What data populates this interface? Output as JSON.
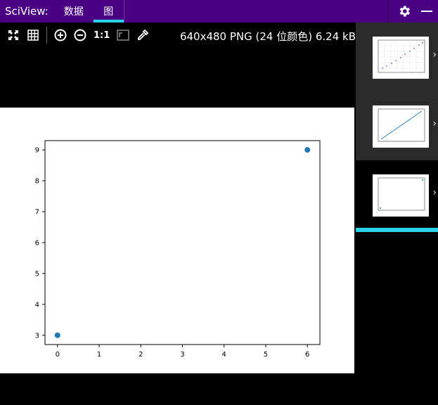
{
  "app": {
    "name": "SciView:"
  },
  "tabs": [
    {
      "label": "数据",
      "active": false
    },
    {
      "label": "图",
      "active": true
    }
  ],
  "toolbar": {
    "icons": [
      "fit-icon",
      "grid-icon",
      "zoom-in-icon",
      "zoom-out-icon",
      "actual-size-label",
      "background-icon",
      "color-picker-icon"
    ],
    "actual_size_label": "1:1",
    "image_info": "640x480 PNG (24 位颜色) 6.24 kB"
  },
  "chart_data": {
    "type": "scatter",
    "x": [
      0,
      6
    ],
    "y": [
      3,
      9
    ],
    "xlim": [
      -0.3,
      6.3
    ],
    "ylim": [
      2.7,
      9.3
    ],
    "xticks": [
      "0",
      "1",
      "2",
      "3",
      "4",
      "5",
      "6"
    ],
    "yticks": [
      "3",
      "4",
      "5",
      "6",
      "7",
      "8",
      "9"
    ],
    "grid": false,
    "color": "#1f77b4"
  },
  "thumbnails": [
    {
      "kind": "scatter-grid",
      "selected": false
    },
    {
      "kind": "line",
      "selected": false
    },
    {
      "kind": "scatter",
      "selected": true
    }
  ],
  "colors": {
    "topbar": "#4b0082",
    "accent": "#29d2e6"
  }
}
